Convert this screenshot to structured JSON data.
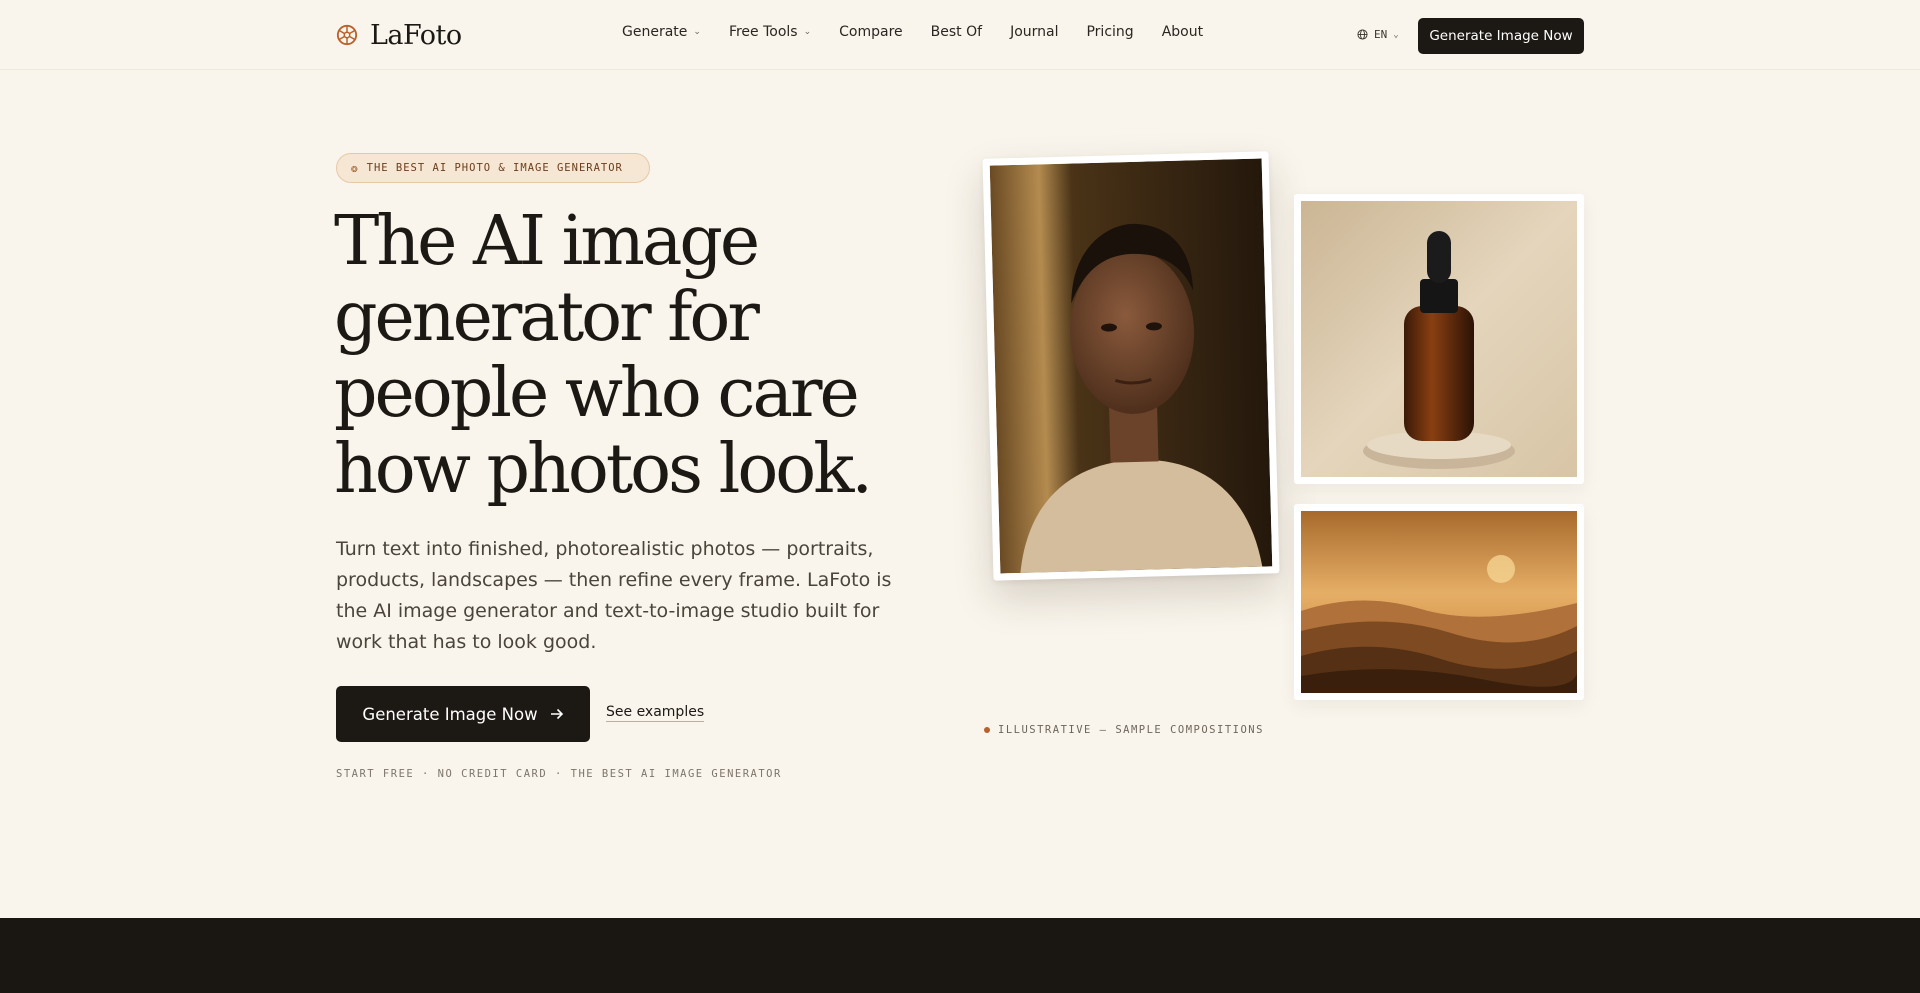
{
  "nav": {
    "brand": "LaFoto",
    "links": [
      {
        "label": "Generate",
        "dropdown": true
      },
      {
        "label": "Free Tools",
        "dropdown": true
      },
      {
        "label": "Compare",
        "dropdown": false
      },
      {
        "label": "Best Of",
        "dropdown": false
      },
      {
        "label": "Journal",
        "dropdown": false
      },
      {
        "label": "Pricing",
        "dropdown": false
      },
      {
        "label": "About",
        "dropdown": false
      }
    ],
    "language": "EN",
    "cta": "Generate Image Now"
  },
  "hero": {
    "badge": "THE BEST AI PHOTO & IMAGE GENERATOR",
    "headline_lines": [
      "The AI image",
      "generator for",
      "people who care",
      "how photos look."
    ],
    "subtitle": "Turn text into finished, photorealistic photos — portraits, products, landscapes — then refine every frame. LaFoto is the AI image generator and text-to-image studio built for work that has to look good.",
    "primary_cta": "Generate Image Now",
    "secondary_cta": "See examples",
    "fineprint": "START FREE · NO CREDIT CARD · THE BEST AI IMAGE GENERATOR",
    "caption": "ILLUSTRATIVE — SAMPLE COMPOSITIONS"
  },
  "colors": {
    "background": "#f9f5ec",
    "ink": "#1c1813",
    "accent": "#b8612a",
    "dark_band": "#1a1712"
  },
  "icons": {
    "logo": "aperture-icon",
    "language": "globe-icon",
    "cta_arrow": "arrow-right-icon"
  }
}
